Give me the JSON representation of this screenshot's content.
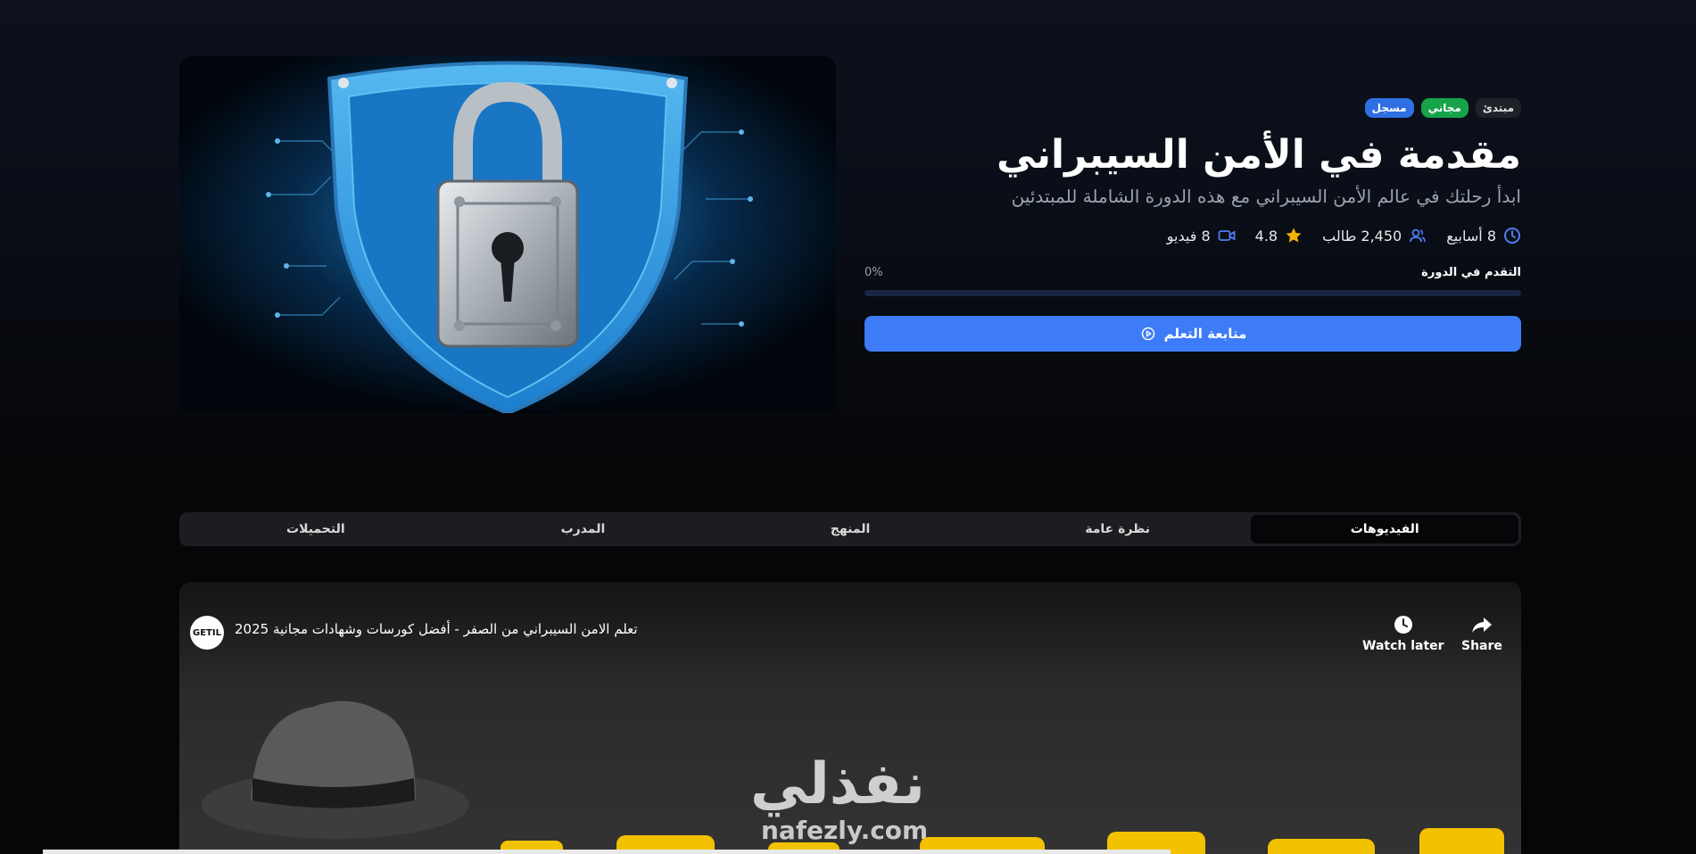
{
  "course": {
    "badges": {
      "level": "مبتدئ",
      "free": "مجاني",
      "enrolled": "مسجل"
    },
    "title": "مقدمة في الأمن السيبراني",
    "subtitle": "ابدأ رحلتك في عالم الأمن السيبراني مع هذه الدورة الشاملة للمبتدئين",
    "meta": {
      "duration": "8 أسابيع",
      "students": "2,450 طالب",
      "rating": "4.8",
      "videos": "8 فيديو"
    },
    "progress": {
      "label": "التقدم في الدورة",
      "percent_text": "0%",
      "value": 0
    },
    "continue_label": "متابعة التعلم"
  },
  "tabs": [
    {
      "label": "الفيديوهات",
      "active": true
    },
    {
      "label": "نظرة عامة",
      "active": false
    },
    {
      "label": "المنهج",
      "active": false
    },
    {
      "label": "المدرب",
      "active": false
    },
    {
      "label": "التحميلات",
      "active": false
    }
  ],
  "video": {
    "title": "تعلم الامن السيبراني من الصفر - أفضل كورسات وشهادات مجانية 2025",
    "channel_logo_text": "GETIL",
    "watch_later": "Watch later",
    "share": "Share",
    "watermark_ar": "نفذلي",
    "watermark_en": "nafezly.com"
  },
  "colors": {
    "accent": "#3d7bf7",
    "free": "#16a34a",
    "enrolled": "#2f6fe4",
    "star": "#f5b301"
  }
}
